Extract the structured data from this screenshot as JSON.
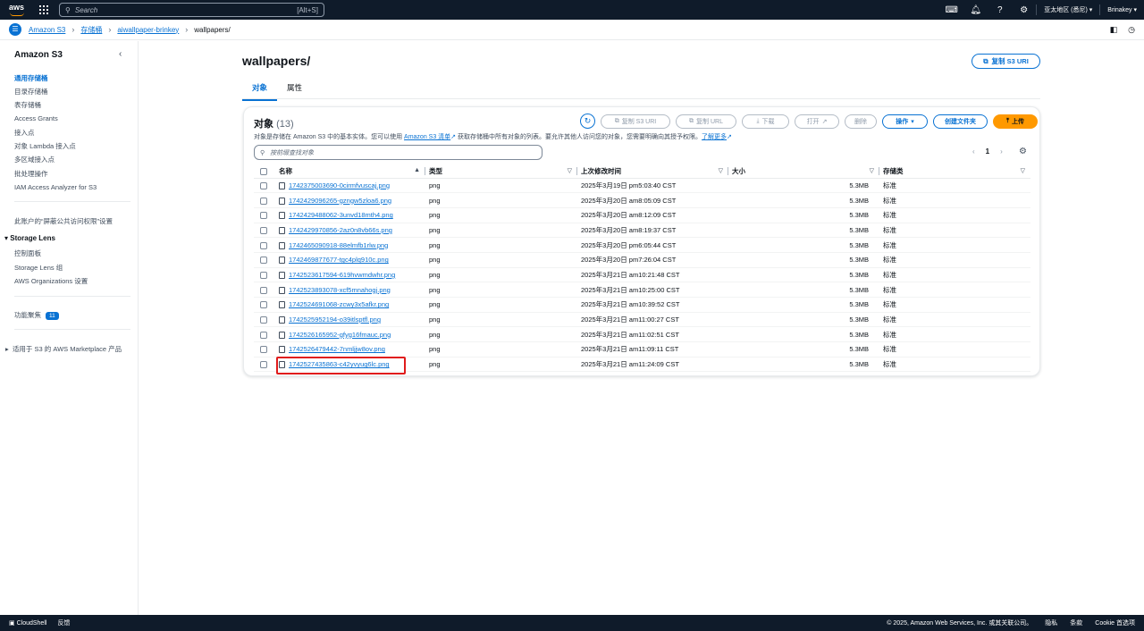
{
  "topbar": {
    "logo": "aws",
    "search_placeholder": "Search",
    "search_shortcut": "[Alt+S]",
    "region": "亚太地区 (悉尼)",
    "user": "Brinakey"
  },
  "breadcrumb": [
    "Amazon S3",
    "存储桶",
    "aiwallpaper-brinkey",
    "wallpapers/"
  ],
  "sidebar": {
    "title": "Amazon S3",
    "items": [
      "通用存储桶",
      "目录存储桶",
      "表存储桶",
      "Access Grants",
      "接入点",
      "对象 Lambda 接入点",
      "多区域接入点",
      "批处理操作",
      "IAM Access Analyzer for S3"
    ],
    "account_setting": "此账户的“屏蔽公共访问权限”设置",
    "storage_lens": {
      "title": "Storage Lens",
      "items": [
        "控制面板",
        "Storage Lens 组",
        "AWS Organizations 设置"
      ]
    },
    "feature_spotlight": "功能聚焦",
    "feature_count": "11",
    "marketplace": "适用于 S3 的 AWS Marketplace 产品"
  },
  "page": {
    "title": "wallpapers/",
    "copy_uri_button": "复制 S3 URI",
    "tabs": [
      "对象",
      "属性"
    ]
  },
  "objects": {
    "title": "对象",
    "count": "(13)",
    "desc_before": "对象是存储在 Amazon S3 中的基本实体。您可以使用 ",
    "desc_link": "Amazon S3 清单",
    "desc_after": " 获取存储桶中所有对象的列表。要允许其他人访问您的对象，您需要明确向其授予权限。",
    "learn_more": "了解更多",
    "buttons": {
      "copy_s3_uri": "复制 S3 URI",
      "copy_url": "复制 URL",
      "download": "下载",
      "open": "打开",
      "delete": "删除",
      "actions": "操作",
      "create_folder": "创建文件夹",
      "upload": "上传"
    },
    "find_placeholder": "按前缀查找对象",
    "page_number": "1",
    "columns": [
      "名称",
      "类型",
      "上次修改时间",
      "大小",
      "存储类"
    ],
    "rows": [
      {
        "name": "1742375003690-0cirmfvuscaj.png",
        "type": "png",
        "modified": "2025年3月19日 pm5:03:40 CST",
        "size": "5.3MB",
        "class": "标准"
      },
      {
        "name": "1742429096265-gzngw5zloa6.png",
        "type": "png",
        "modified": "2025年3月20日 am8:05:09 CST",
        "size": "5.3MB",
        "class": "标准"
      },
      {
        "name": "1742429488062-3unvd18mth4.png",
        "type": "png",
        "modified": "2025年3月20日 am8:12:09 CST",
        "size": "5.3MB",
        "class": "标准"
      },
      {
        "name": "1742429970856-2az0n8vb66s.png",
        "type": "png",
        "modified": "2025年3月20日 am8:19:37 CST",
        "size": "5.3MB",
        "class": "标准"
      },
      {
        "name": "1742465090918-88elmfb1rlw.png",
        "type": "png",
        "modified": "2025年3月20日 pm6:05:44 CST",
        "size": "5.3MB",
        "class": "标准"
      },
      {
        "name": "1742469877677-tgc4plq910c.png",
        "type": "png",
        "modified": "2025年3月20日 pm7:26:04 CST",
        "size": "5.3MB",
        "class": "标准"
      },
      {
        "name": "1742523617594-619hvwmdwhr.png",
        "type": "png",
        "modified": "2025年3月21日 am10:21:48 CST",
        "size": "5.3MB",
        "class": "标准"
      },
      {
        "name": "1742523893078-xcf5mnahogj.png",
        "type": "png",
        "modified": "2025年3月21日 am10:25:00 CST",
        "size": "5.3MB",
        "class": "标准"
      },
      {
        "name": "1742524691068-zcwy3x5afkr.png",
        "type": "png",
        "modified": "2025年3月21日 am10:39:52 CST",
        "size": "5.3MB",
        "class": "标准"
      },
      {
        "name": "1742525952194-o39itlsptfl.png",
        "type": "png",
        "modified": "2025年3月21日 am11:00:27 CST",
        "size": "5.3MB",
        "class": "标准"
      },
      {
        "name": "1742526165952-gfyg16fmauc.png",
        "type": "png",
        "modified": "2025年3月21日 am11:02:51 CST",
        "size": "5.3MB",
        "class": "标准"
      },
      {
        "name": "1742526479442-7nmljjw8ov.png",
        "type": "png",
        "modified": "2025年3月21日 am11:09:11 CST",
        "size": "5.3MB",
        "class": "标准"
      },
      {
        "name": "1742527435863-c42yvyug6lc.png",
        "type": "png",
        "modified": "2025年3月21日 am11:24:09 CST",
        "size": "5.3MB",
        "class": "标准"
      }
    ]
  },
  "footer": {
    "cloudshell": "CloudShell",
    "feedback": "反馈",
    "copyright": "© 2025, Amazon Web Services, Inc. 或其关联公司。",
    "privacy": "隐私",
    "terms": "条款",
    "cookie": "Cookie 首选项"
  },
  "colors": {
    "accent": "#0972d3",
    "orange": "#ff9900",
    "topbar": "#0f1b2a",
    "highlight": "#e01b1b"
  }
}
